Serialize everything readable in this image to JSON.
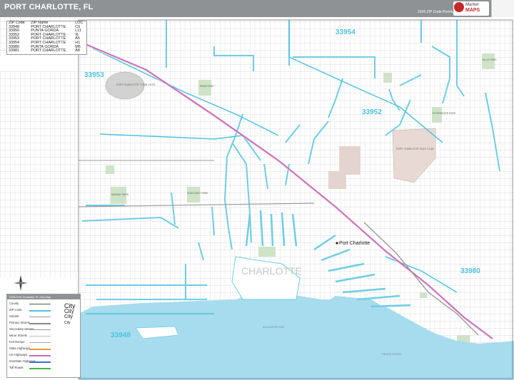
{
  "header": {
    "title": "PORT CHARLOTTE, FL",
    "edition": "2026 ZIP Code Premium Edition",
    "logo_line1": "Market",
    "logo_line2": "MAPS"
  },
  "zip_table": {
    "headers": [
      "ZIP Code",
      "ZIP Name",
      "LOC"
    ],
    "rows": [
      [
        "33948",
        "PORT CHARLOTTE",
        "C6"
      ],
      [
        "33950",
        "PUNTA GORDA",
        "L11"
      ],
      [
        "33952",
        "PORT CHARLOTTE",
        "I6"
      ],
      [
        "33953",
        "PORT CHARLOTTE",
        "A5"
      ],
      [
        "33954",
        "PORT CHARLOTTE",
        "H1"
      ],
      [
        "33980",
        "PUNTA GORDA",
        "M6"
      ],
      [
        "33981",
        "PORT CHARLOTTE",
        "A8"
      ]
    ]
  },
  "map": {
    "zip_labels": [
      "33954",
      "33953",
      "33952",
      "33948",
      "33980"
    ],
    "city_label": "CHARLOTTE",
    "place_label": "Port Charlotte",
    "water_labels": [
      "ALLIGATOR BAY",
      "PEACE RIVER"
    ],
    "park_labels": [
      "PORT CHARLOTTE TOWN CNTR",
      "TRAIN PARK",
      "MIDWAY PARK",
      "SUNCOAST PARK",
      "PORT CHARLOTTE GOLF CLUB",
      "ELLIS PARK",
      "EDGEWATER PARK"
    ],
    "colors": {
      "water": "#a6dced",
      "canal": "#6ecde4",
      "park": "#cfe3c8",
      "urban": "#d2d2d2",
      "highway": "#c86fb7",
      "zip_boundary": "#4fc3e0",
      "streets": "#9a9a9a"
    }
  },
  "legend": {
    "title": "2026 Port Charlotte, FL City Map",
    "items": [
      "County",
      "ZIP Code",
      "Streets",
      "Primary Streets",
      "Secondary Streets",
      "Minor Streets",
      "Exit Ramps",
      "State Highways",
      "US Highways",
      "Interstate Highways",
      "Toll Roads"
    ],
    "city_samples": [
      "City",
      "City",
      "City",
      "City"
    ]
  },
  "compass": {
    "label": "N"
  }
}
